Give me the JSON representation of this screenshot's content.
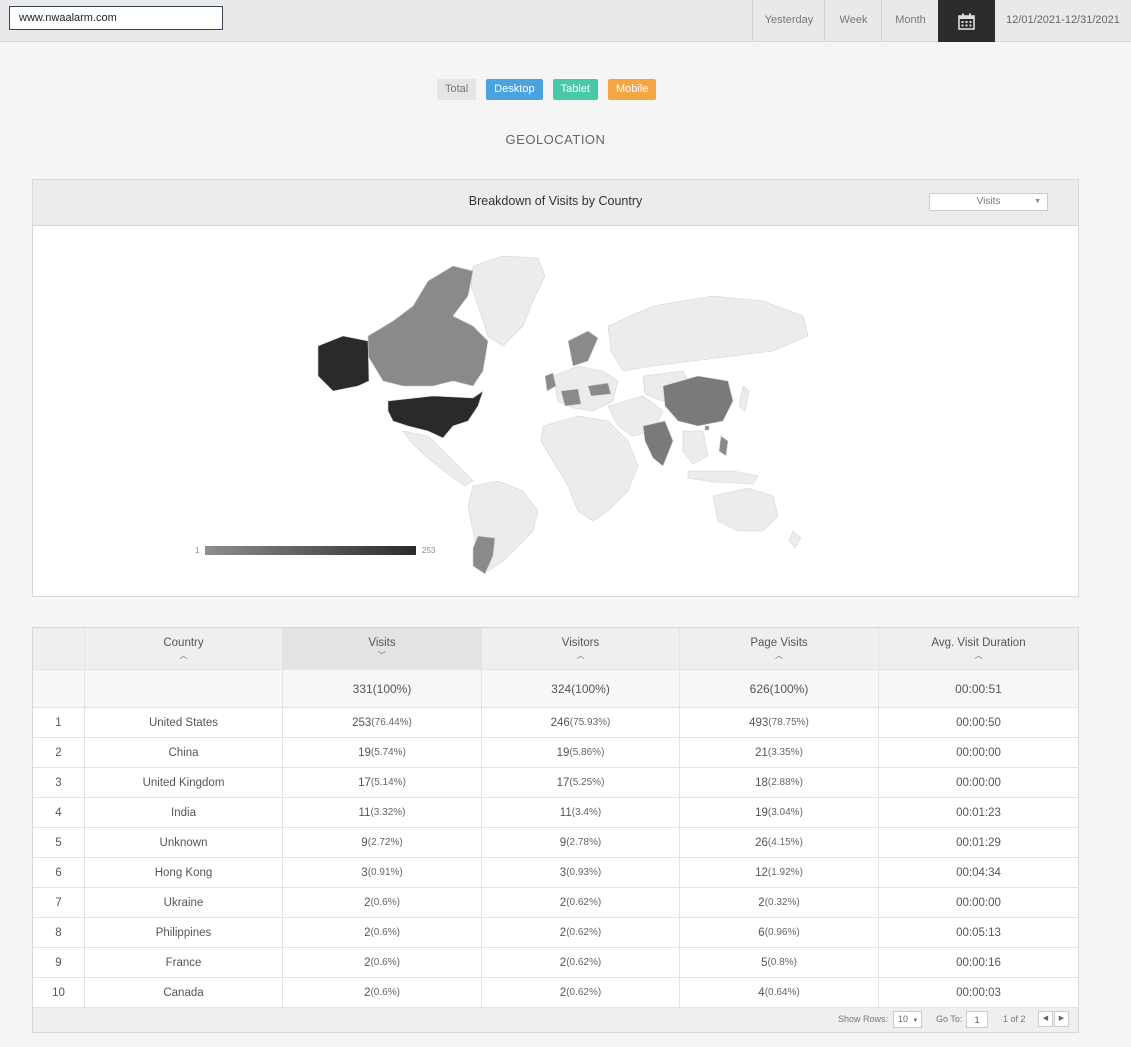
{
  "site": {
    "value": "www.nwaalarm.com"
  },
  "range": {
    "yesterday": "Yesterday",
    "week": "Week",
    "month": "Month",
    "date": "12/01/2021-12/31/2021",
    "calendar_icon": "calendar-icon"
  },
  "filters": {
    "total": "Total",
    "desktop": "Desktop",
    "tablet": "Tablet",
    "mobile": "Mobile"
  },
  "colors": {
    "desktop": "#4aa3df",
    "tablet": "#48c9a5",
    "mobile": "#f5a542",
    "map_max": "#2a2a2a",
    "map_min": "#8e8e8e",
    "map_none": "#ececec"
  },
  "section": {
    "title": "GEOLOCATION"
  },
  "map": {
    "title": "Breakdown of Visits by Country",
    "metric": "Visits",
    "legend_min": "1",
    "legend_max": "253"
  },
  "table": {
    "headers": {
      "country": "Country",
      "visits": "Visits",
      "visitors": "Visitors",
      "pages": "Page Visits",
      "duration": "Avg. Visit Duration"
    },
    "totals": {
      "visits": "331(100%)",
      "visitors": "324(100%)",
      "pages": "626(100%)",
      "duration": "00:00:51"
    },
    "rows": [
      {
        "idx": "1",
        "country": "United States",
        "visits": "253",
        "visits_pct": "(76.44%)",
        "visitors": "246",
        "visitors_pct": "(75.93%)",
        "pages": "493",
        "pages_pct": "(78.75%)",
        "duration": "00:00:50"
      },
      {
        "idx": "2",
        "country": "China",
        "visits": "19",
        "visits_pct": "(5.74%)",
        "visitors": "19",
        "visitors_pct": "(5.86%)",
        "pages": "21",
        "pages_pct": "(3.35%)",
        "duration": "00:00:00"
      },
      {
        "idx": "3",
        "country": "United Kingdom",
        "visits": "17",
        "visits_pct": "(5.14%)",
        "visitors": "17",
        "visitors_pct": "(5.25%)",
        "pages": "18",
        "pages_pct": "(2.88%)",
        "duration": "00:00:00"
      },
      {
        "idx": "4",
        "country": "India",
        "visits": "11",
        "visits_pct": "(3.32%)",
        "visitors": "11",
        "visitors_pct": "(3.4%)",
        "pages": "19",
        "pages_pct": "(3.04%)",
        "duration": "00:01:23"
      },
      {
        "idx": "5",
        "country": "Unknown",
        "visits": "9",
        "visits_pct": "(2.72%)",
        "visitors": "9",
        "visitors_pct": "(2.78%)",
        "pages": "26",
        "pages_pct": "(4.15%)",
        "duration": "00:01:29"
      },
      {
        "idx": "6",
        "country": "Hong Kong",
        "visits": "3",
        "visits_pct": "(0.91%)",
        "visitors": "3",
        "visitors_pct": "(0.93%)",
        "pages": "12",
        "pages_pct": "(1.92%)",
        "duration": "00:04:34"
      },
      {
        "idx": "7",
        "country": "Ukraine",
        "visits": "2",
        "visits_pct": "(0.6%)",
        "visitors": "2",
        "visitors_pct": "(0.62%)",
        "pages": "2",
        "pages_pct": "(0.32%)",
        "duration": "00:00:00"
      },
      {
        "idx": "8",
        "country": "Philippines",
        "visits": "2",
        "visits_pct": "(0.6%)",
        "visitors": "2",
        "visitors_pct": "(0.62%)",
        "pages": "6",
        "pages_pct": "(0.96%)",
        "duration": "00:05:13"
      },
      {
        "idx": "9",
        "country": "France",
        "visits": "2",
        "visits_pct": "(0.6%)",
        "visitors": "2",
        "visitors_pct": "(0.62%)",
        "pages": "5",
        "pages_pct": "(0.8%)",
        "duration": "00:00:16"
      },
      {
        "idx": "10",
        "country": "Canada",
        "visits": "2",
        "visits_pct": "(0.6%)",
        "visitors": "2",
        "visitors_pct": "(0.62%)",
        "pages": "4",
        "pages_pct": "(0.64%)",
        "duration": "00:00:03"
      }
    ],
    "footer": {
      "show_rows_label": "Show Rows:",
      "show_rows_value": "10",
      "goto_label": "Go To:",
      "goto_value": "1",
      "page_count": "1 of 2"
    }
  }
}
